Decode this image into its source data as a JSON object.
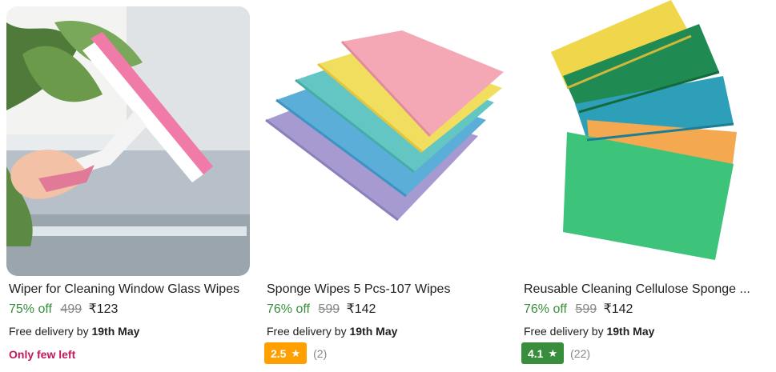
{
  "products": [
    {
      "title": "Wiper for Cleaning Window Glass Wipes",
      "discount": "75% off",
      "mrp": "499",
      "price": "₹123",
      "delivery_prefix": "Free delivery by",
      "delivery_date": "19th May",
      "stock_note": "Only few left"
    },
    {
      "title": "Sponge Wipes 5 Pcs-107 Wipes",
      "discount": "76% off",
      "mrp": "599",
      "price": "₹142",
      "delivery_prefix": "Free delivery by",
      "delivery_date": "19th May",
      "rating": "2.5",
      "rating_count": "(2)",
      "rating_color": "#ff9f00"
    },
    {
      "title": "Reusable Cleaning Cellulose Sponge ...",
      "discount": "76% off",
      "mrp": "599",
      "price": "₹142",
      "delivery_prefix": "Free delivery by",
      "delivery_date": "19th May",
      "rating": "4.1",
      "rating_count": "(22)",
      "rating_color": "#388e3c"
    }
  ],
  "icons": {
    "star": "★"
  },
  "colors": {
    "discount_green": "#388e3c",
    "few_left_pink": "#c2185b",
    "strike_gray": "#878787"
  }
}
